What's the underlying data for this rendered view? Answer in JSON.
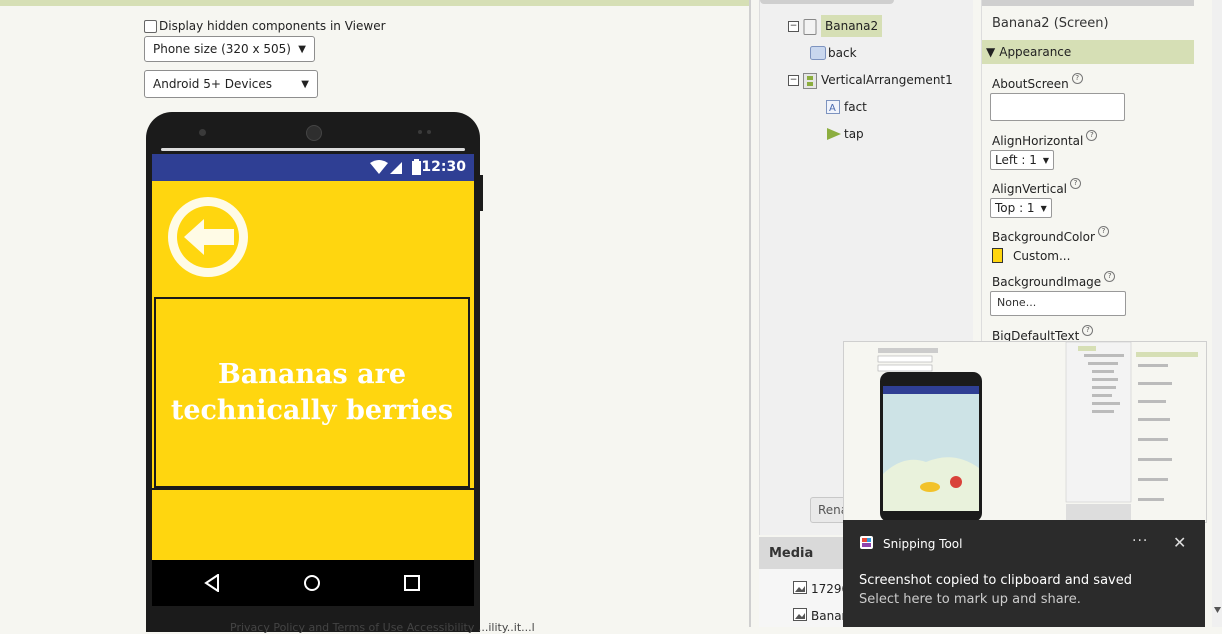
{
  "viewer": {
    "hidden_components_label": "Display hidden components in Viewer",
    "size_select": "Phone size (320 x 505)",
    "device_select": "Android 5+ Devices",
    "footer_text": "Privacy Policy and Terms of Use    Accessibility    ...ility..it...l"
  },
  "phone": {
    "time": "12:30",
    "fact_text_line1": "Bananas are",
    "fact_text_line2": "technically berries",
    "screen_color": "#ffd60f",
    "status_color": "#2f3f94"
  },
  "components": {
    "tree": [
      {
        "label": "Banana2",
        "toggle": "⊟"
      },
      {
        "label": "back"
      },
      {
        "label": "VerticalArrangement1",
        "toggle": "⊟"
      },
      {
        "label": "fact"
      },
      {
        "label": "tap"
      }
    ],
    "rename_label": "Rena"
  },
  "media": {
    "header": "Media",
    "items": [
      "17296",
      "Banan"
    ]
  },
  "properties": {
    "title": "Banana2 (Screen)",
    "section": "Appearance",
    "about_screen_label": "AboutScreen",
    "align_h_label": "AlignHorizontal",
    "align_h_value": "Left : 1",
    "align_v_label": "AlignVertical",
    "align_v_value": "Top : 1",
    "bg_color_label": "BackgroundColor",
    "bg_color_value": "Custom...",
    "bg_image_label": "BackgroundImage",
    "bg_image_value": "None...",
    "big_default_label": "BigDefaultText"
  },
  "toast": {
    "app_name": "Snipping Tool",
    "message": "Screenshot copied to clipboard and saved",
    "sub": "Select here to mark up and share."
  }
}
